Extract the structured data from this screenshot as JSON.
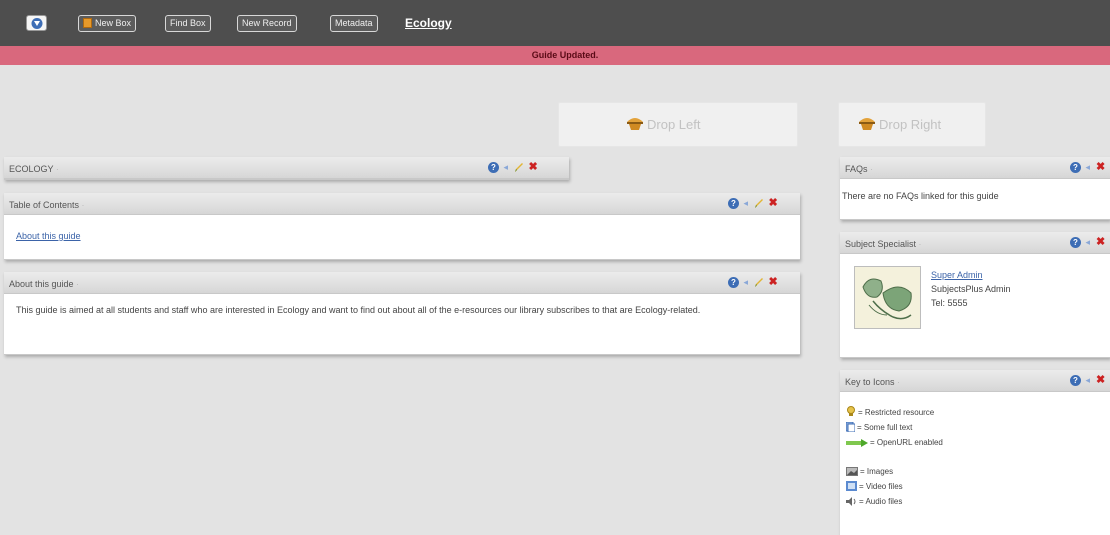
{
  "toolbar": {
    "new_box": "New Box",
    "find_box": "Find Box",
    "new_record": "New Record",
    "metadata": "Metadata",
    "guide_title": "Ecology"
  },
  "banner": {
    "message": "Guide Updated."
  },
  "drop_zones": {
    "left": "Drop Left",
    "right": "Drop Right"
  },
  "left_column": {
    "ecology_box": {
      "title": "ECOLOGY"
    },
    "toc_box": {
      "title": "Table of Contents",
      "link": "About this guide"
    },
    "about_box": {
      "title": "About this guide",
      "body": "This guide is aimed at all students and staff who are interested in Ecology and want to find out about all of the e-resources our library subscribes to that are Ecology-related."
    }
  },
  "right_column": {
    "faqs_box": {
      "title": "FAQs",
      "body": "There are no FAQs linked for this guide"
    },
    "specialist_box": {
      "title": "Subject Specialist",
      "name": "Super Admin",
      "role": "SubjectsPlus Admin",
      "phone": "Tel: 5555"
    },
    "key_box": {
      "title": "Key to Icons",
      "items": [
        {
          "icon": "restricted-icon",
          "label": "= Restricted resource"
        },
        {
          "icon": "fulltext-icon",
          "label": "= Some full text"
        },
        {
          "icon": "openurl-icon",
          "label": "= OpenURL enabled"
        },
        {
          "icon": "images-icon",
          "label": "= Images"
        },
        {
          "icon": "video-icon",
          "label": "= Video files"
        },
        {
          "icon": "audio-icon",
          "label": "= Audio files"
        }
      ]
    }
  },
  "colors": {
    "toolbar_bg": "#4e4e4e",
    "banner_bg": "#d9687d",
    "page_bg": "#e3e3e3",
    "link": "#3b63a8"
  }
}
